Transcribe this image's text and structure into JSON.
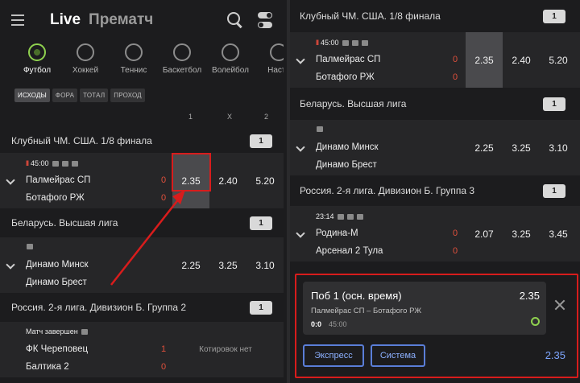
{
  "header": {
    "live_tab": "Live",
    "prematch_tab": "Прематч"
  },
  "sports": [
    "Футбол",
    "Хоккей",
    "Теннис",
    "Баскетбол",
    "Волейбол",
    "Насто"
  ],
  "chips": [
    "ИСХОДЫ",
    "ФОРА",
    "ТОТАЛ",
    "ПРОХОД"
  ],
  "columns": [
    "1",
    "X",
    "2"
  ],
  "leagues": {
    "mls": {
      "name": "Клубный ЧМ. США. 1/8 финала",
      "count": "1"
    },
    "belarus": {
      "name": "Беларусь. Высшая лига",
      "count": "1"
    },
    "russia": {
      "name": "Россия. 2-я лига. Дивизион Б. Группа 2",
      "count": "1"
    },
    "russia3": {
      "name": "Россия. 2-я лига. Дивизион Б. Группа 3",
      "count": "1"
    }
  },
  "matches": {
    "palmeiras": {
      "time": "45:00",
      "team1": "Палмейрас СП",
      "team2": "Ботафого РЖ",
      "score1": "0",
      "score2": "0",
      "odd1": "2.35",
      "oddx": "2.40",
      "odd2": "5.20"
    },
    "dinamo": {
      "team1": "Динамо Минск",
      "team2": "Динамо Брест",
      "odd1": "2.25",
      "oddx": "3.25",
      "odd2": "3.10"
    },
    "cherepovets": {
      "status": "Матч завершен",
      "team1": "ФК Череповец",
      "team2": "Балтика 2",
      "score1": "1",
      "score2": "0",
      "no_odds": "Котировок нет"
    },
    "rodina": {
      "time": "23:14",
      "team1": "Родина-М",
      "team2": "Арсенал 2 Тула",
      "score1": "0",
      "score2": "0",
      "odd1": "2.07",
      "oddx": "3.25",
      "odd2": "3.45"
    }
  },
  "slip": {
    "title": "Поб 1 (осн. время)",
    "odd": "2.35",
    "teams": "Палмейрас СП – Ботафого РЖ",
    "score": "0:0",
    "time": "45:00",
    "express": "Экспресс",
    "system": "Система",
    "total": "2.35"
  },
  "colors": {
    "accent": "#d81c1c",
    "sport_active": "#8fd14f",
    "link": "#5a7ed8"
  }
}
